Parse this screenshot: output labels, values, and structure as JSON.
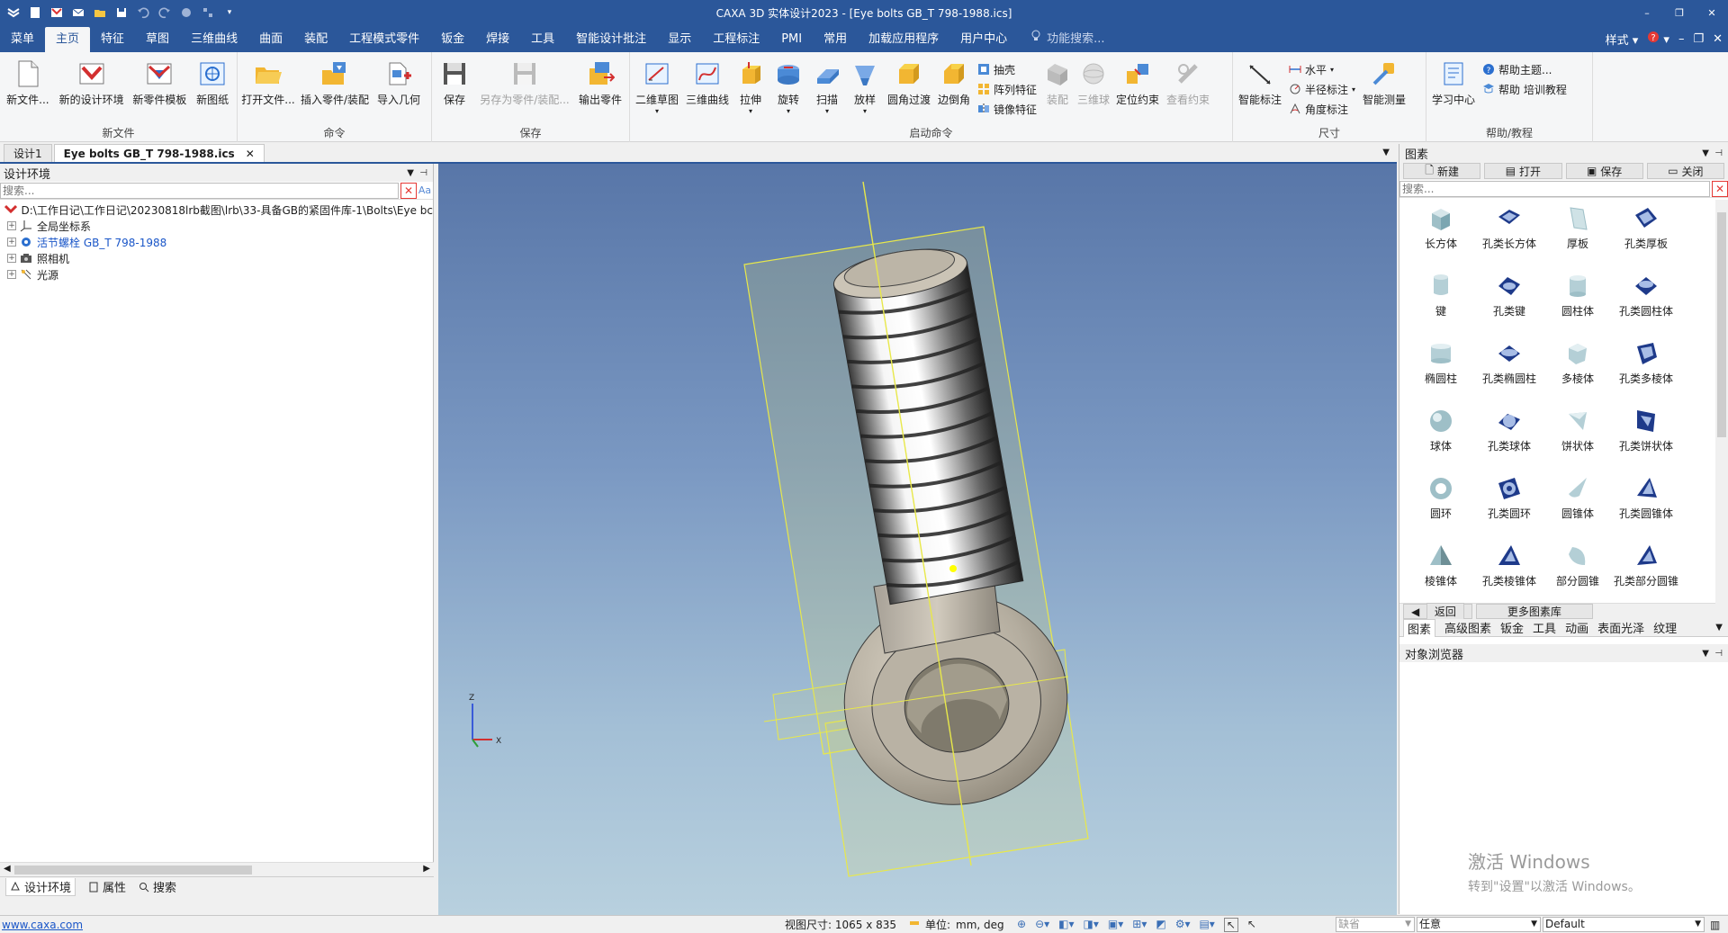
{
  "titlebar": {
    "title": "CAXA 3D 实体设计2023 - [Eye bolts GB_T 798-1988.ics]",
    "window_controls": [
      "–",
      "❐",
      "✕"
    ]
  },
  "menu": {
    "tabs": [
      "菜单",
      "主页",
      "特征",
      "草图",
      "三维曲线",
      "曲面",
      "装配",
      "工程模式零件",
      "钣金",
      "焊接",
      "工具",
      "智能设计批注",
      "显示",
      "工程标注",
      "PMI",
      "常用",
      "加载应用程序",
      "用户中心"
    ],
    "active_index": 1,
    "search_placeholder": "功能搜索...",
    "style_label": "样式",
    "window_controls": [
      "–",
      "❐",
      "✕"
    ]
  },
  "ribbon": {
    "groups": {
      "new_file": {
        "name": "新文件",
        "buttons": [
          "新文件...",
          "新的设计环境",
          "新零件模板",
          "新图纸"
        ]
      },
      "command": {
        "name": "命令",
        "buttons": [
          "打开文件...",
          "插入零件/装配",
          "导入几何"
        ]
      },
      "save": {
        "name": "保存",
        "buttons": [
          "保存",
          "另存为零件/装配...",
          "输出零件"
        ]
      },
      "launch": {
        "name": "启动命令",
        "buttons": [
          "二维草图",
          "三维曲线",
          "拉伸",
          "旋转",
          "扫描",
          "放样",
          "圆角过渡",
          "边倒角"
        ],
        "small": [
          "抽壳",
          "阵列特征",
          "镜像特征"
        ],
        "buttons2": [
          "装配",
          "三维球",
          "定位约束",
          "查看约束"
        ]
      },
      "dimension": {
        "name": "尺寸",
        "buttons": [
          "智能标注"
        ],
        "small": [
          "水平",
          "半径标注",
          "角度标注"
        ],
        "buttons2": [
          "智能测量"
        ]
      },
      "help": {
        "name": "帮助/教程",
        "buttons": [
          "学习中心"
        ],
        "small": [
          "帮助主题...",
          "帮助 培训教程"
        ]
      }
    }
  },
  "doc_tabs": {
    "tabs": [
      "设计1",
      "Eye bolts GB_T 798-1988.ics"
    ],
    "active_index": 1,
    "close_glyph": "✕"
  },
  "left_panel": {
    "title": "设计环境",
    "search_placeholder": "搜索...",
    "tree": [
      "D:\\工作日记\\工作日记\\20230818lrb截图\\lrb\\33-具备GB的紧固件库-1\\Bolts\\Eye bc",
      "全局坐标系",
      "活节螺栓 GB_T 798-1988",
      "照相机",
      "光源"
    ],
    "bottom_tabs": [
      "设计环境",
      "属性",
      "搜索"
    ]
  },
  "viewport": {
    "axis_labels": {
      "z": "Z",
      "x": "X"
    }
  },
  "right_panel": {
    "title": "图素",
    "toolbar": [
      "新建",
      "打开",
      "保存",
      "关闭"
    ],
    "search_placeholder": "搜索...",
    "items": [
      "长方体",
      "孔类长方体",
      "厚板",
      "孔类厚板",
      "键",
      "孔类键",
      "圆柱体",
      "孔类圆柱体",
      "椭圆柱",
      "孔类椭圆柱",
      "多棱体",
      "孔类多棱体",
      "球体",
      "孔类球体",
      "饼状体",
      "孔类饼状体",
      "圆环",
      "孔类圆环",
      "圆锥体",
      "孔类圆锥体",
      "棱锥体",
      "孔类棱锥体",
      "部分圆锥",
      "孔类部分圆锥"
    ],
    "nav_back": "返回",
    "nav_more": "更多图素库",
    "tabs": [
      "图素",
      "高级图素",
      "钣金",
      "工具",
      "动画",
      "表面光泽",
      "纹理"
    ],
    "object_browser_title": "对象浏览器",
    "watermark_line1": "激活 Windows",
    "watermark_line2": "转到\"设置\"以激活 Windows。"
  },
  "statusbar": {
    "link": "www.caxa.com",
    "view_size": "视图尺寸: 1065 x  835",
    "unit_label": "单位:",
    "unit_value": "mm, deg",
    "select1": "缺省",
    "select2": "任意",
    "select3": "Default"
  },
  "colors": {
    "brand": "#2b579a",
    "selection_box": "#e8e84a",
    "link": "#1a56c8"
  }
}
